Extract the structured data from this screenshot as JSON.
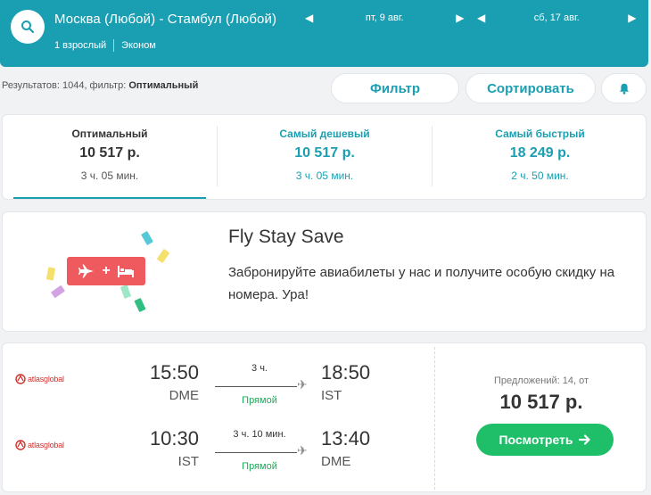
{
  "header": {
    "route": "Москва (Любой) - Стамбул (Любой)",
    "passengers": "1 взрослый",
    "cabin": "Эконом",
    "depart_date": "пт, 9 авг.",
    "return_date": "сб, 17 авг."
  },
  "results": {
    "prefix": "Результатов: 1044, фильтр:",
    "filter_value": "Оптимальный"
  },
  "toolbar": {
    "filter_label": "Фильтр",
    "sort_label": "Сортировать"
  },
  "tabs": [
    {
      "title": "Оптимальный",
      "price": "10 517 р.",
      "duration": "3 ч. 05 мин."
    },
    {
      "title": "Самый дешевый",
      "price": "10 517 р.",
      "duration": "3 ч. 05 мин."
    },
    {
      "title": "Самый быстрый",
      "price": "18 249 р.",
      "duration": "2 ч. 50 мин."
    }
  ],
  "promo": {
    "title": "Fly Stay Save",
    "text": "Забронируйте авиабилеты у нас и получите особую скидку на номера. Ура!",
    "badge_plus": "+"
  },
  "flight": {
    "airline_name": "atlasglobal",
    "legs": [
      {
        "dep_time": "15:50",
        "dep_code": "DME",
        "duration": "3 ч.",
        "type": "Прямой",
        "arr_time": "18:50",
        "arr_code": "IST"
      },
      {
        "dep_time": "10:30",
        "dep_code": "IST",
        "duration": "3 ч. 10 мин.",
        "type": "Прямой",
        "arr_time": "13:40",
        "arr_code": "DME"
      }
    ],
    "offers": "Предложений: 14, от",
    "price": "10 517 р.",
    "view_label": "Посмотреть"
  },
  "colors": {
    "brand": "#1a9fb2",
    "button_green": "#1fbf6a",
    "promo_red": "#ef5a5f",
    "direct_green": "#1aab5a"
  },
  "icons": [
    "search-icon",
    "chevron-left-icon",
    "chevron-right-icon",
    "bell-icon",
    "plane-icon",
    "bed-icon",
    "arrow-right-icon",
    "atlasglobal-logo"
  ]
}
